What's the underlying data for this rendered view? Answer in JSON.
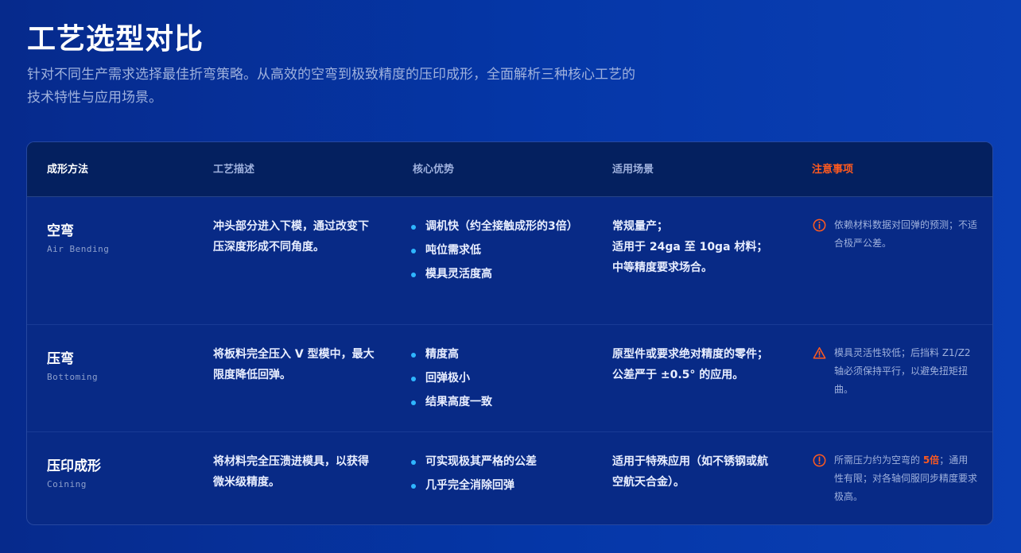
{
  "page": {
    "title": "工艺选型对比",
    "subtitle": "针对不同生产需求选择最佳折弯策略。从高效的空弯到极致精度的压印成形，全面解析三种核心工艺的技术特性与应用场景。"
  },
  "colors": {
    "accent_bullet": "#2fb6ff",
    "warning": "#ff5a1f",
    "header_bg": "#04205f"
  },
  "table": {
    "headers": [
      "成形方法",
      "工艺描述",
      "核心优势",
      "适用场景",
      "注意事项"
    ],
    "rows": [
      {
        "name": "空弯",
        "name_en": "Air Bending",
        "description": "冲头部分进入下模，通过改变下压深度形成不同角度。",
        "advantages": [
          "调机快（约全接触成形的3倍）",
          "吨位需求低",
          "模具灵活度高"
        ],
        "scene": [
          "常规量产；",
          "适用于 24ga 至 10ga 材料；",
          "中等精度要求场合。"
        ],
        "note_icon": "info-circle-icon",
        "note_pre": "依赖材料数据对回弹的预测；不适合极严公差。",
        "note_hl": "",
        "note_post": ""
      },
      {
        "name": "压弯",
        "name_en": "Bottoming",
        "description": "将板料完全压入 V 型模中，最大限度降低回弹。",
        "advantages": [
          "精度高",
          "回弹极小",
          "结果高度一致"
        ],
        "scene": [
          "原型件或要求绝对精度的零件；",
          "公差严于 ±0.5° 的应用。"
        ],
        "note_icon": "warning-triangle-icon",
        "note_pre": "模具灵活性较低；后挡料 Z1/Z2 轴必须保持平行，以避免扭矩扭曲。",
        "note_hl": "",
        "note_post": ""
      },
      {
        "name": "压印成形",
        "name_en": "Coining",
        "description": "将材料完全压溃进模具，以获得微米级精度。",
        "advantages": [
          "可实现极其严格的公差",
          "几乎完全消除回弹"
        ],
        "scene": [
          "适用于特殊应用（如不锈钢或航空航天合金）。"
        ],
        "note_icon": "alert-circle-icon",
        "note_pre": "所需压力约为空弯的 ",
        "note_hl": "5倍",
        "note_post": "；通用性有限；对各轴伺服同步精度要求极高。"
      }
    ]
  }
}
